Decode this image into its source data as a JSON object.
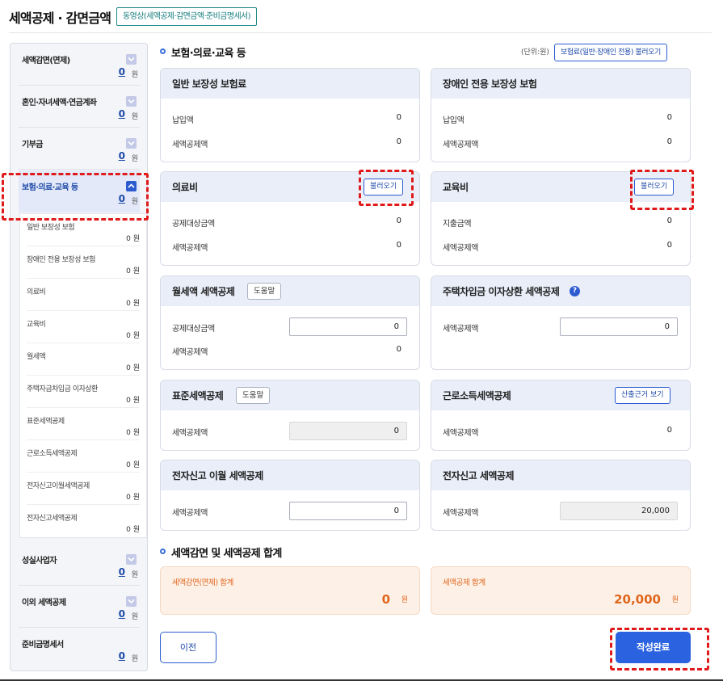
{
  "header": {
    "title": "세액공제 · 감면금액",
    "video_button": "동영상(세액공제·감면금액·준비금명세서)"
  },
  "sidebar": {
    "items": [
      {
        "label": "세액감면(면제)",
        "value": "0",
        "unit": "원"
      },
      {
        "label": "혼인·자녀세액·연금계좌",
        "value": "0",
        "unit": "원"
      },
      {
        "label": "기부금",
        "value": "0",
        "unit": "원"
      },
      {
        "label": "보험·의료·교육 등",
        "value": "0",
        "unit": "원"
      },
      {
        "label": "성실사업자",
        "value": "0",
        "unit": "원"
      },
      {
        "label": "이외 세액공제",
        "value": "0",
        "unit": "원"
      },
      {
        "label": "준비금명세서",
        "value": "0",
        "unit": "원"
      }
    ],
    "sub_items": [
      {
        "label": "일반 보장성 보험",
        "value": "0 원"
      },
      {
        "label": "장애인 전용 보장성 보험",
        "value": "0 원"
      },
      {
        "label": "의료비",
        "value": "0 원"
      },
      {
        "label": "교육비",
        "value": "0 원"
      },
      {
        "label": "월세액",
        "value": "0 원"
      },
      {
        "label": "주택자금차입금 이자상환",
        "value": "0 원"
      },
      {
        "label": "표준세액공제",
        "value": "0 원"
      },
      {
        "label": "근로소득세액공제",
        "value": "0 원"
      },
      {
        "label": "전자신고이월세액공제",
        "value": "0 원"
      },
      {
        "label": "전자신고세액공제",
        "value": "0 원"
      }
    ]
  },
  "main": {
    "section1_title": "보험·의료·교육 등",
    "unit_note": "(단위:원)",
    "import_insurance_button": "보험료(일반·장애인 전용) 불러오기",
    "cards": {
      "general_insurance": {
        "title": "일반 보장성 보험료",
        "rows": [
          {
            "label": "납입액",
            "value": "0"
          },
          {
            "label": "세액공제액",
            "value": "0"
          }
        ]
      },
      "disabled_insurance": {
        "title": "장애인 전용 보장성 보험",
        "rows": [
          {
            "label": "납입액",
            "value": "0"
          },
          {
            "label": "세액공제액",
            "value": "0"
          }
        ]
      },
      "medical": {
        "title": "의료비",
        "button": "불러오기",
        "rows": [
          {
            "label": "공제대상금액",
            "value": "0"
          },
          {
            "label": "세액공제액",
            "value": "0"
          }
        ]
      },
      "education": {
        "title": "교육비",
        "button": "불러오기",
        "rows": [
          {
            "label": "지출금액",
            "value": "0"
          },
          {
            "label": "세액공제액",
            "value": "0"
          }
        ]
      },
      "monthly_rent": {
        "title": "월세액 세액공제",
        "help": "도움말",
        "rows": [
          {
            "label": "공제대상금액",
            "value": "0"
          },
          {
            "label": "세액공제액",
            "value": "0"
          }
        ]
      },
      "housing_loan": {
        "title": "주택차입금 이자상환 세액공제",
        "help_icon": "?",
        "rows": [
          {
            "label": "세액공제액",
            "value": "0"
          }
        ]
      },
      "standard": {
        "title": "표준세액공제",
        "help": "도움말",
        "rows": [
          {
            "label": "세액공제액",
            "value": "0"
          }
        ]
      },
      "earned_income": {
        "title": "근로소득세액공제",
        "button": "산출근거 보기",
        "rows": [
          {
            "label": "세액공제액",
            "value": "0"
          }
        ]
      },
      "e_filing_carryover": {
        "title": "전자신고 이월 세액공제",
        "rows": [
          {
            "label": "세액공제액",
            "value": "0"
          }
        ]
      },
      "e_filing": {
        "title": "전자신고 세액공제",
        "rows": [
          {
            "label": "세액공제액",
            "value": "20,000"
          }
        ]
      }
    },
    "section2_title": "세액감면 및 세액공제 합계",
    "totals": {
      "reduction_label": "세액감면(면제) 합계",
      "reduction_value": "0",
      "credit_label": "세액공제 합계",
      "credit_value": "20,000",
      "unit": "원"
    },
    "prev_button": "이전",
    "done_button": "작성완료"
  },
  "colors": {
    "accent": "#2c5bd0",
    "highlight": "#e01a1a",
    "total": "#e0661c"
  }
}
